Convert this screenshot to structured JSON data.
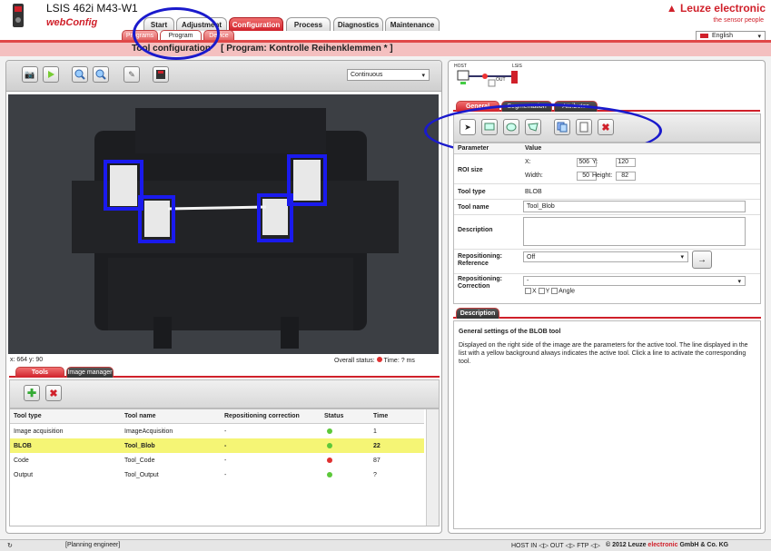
{
  "header": {
    "title": "LSIS 462i M43-W1",
    "subtitle": "webConfig",
    "brand": "Leuze electronic",
    "brand_tagline": "the sensor people",
    "language": "English",
    "main_tabs": [
      "Start",
      "Adjustment",
      "Configuration",
      "Process",
      "Diagnostics",
      "Maintenance"
    ],
    "sub_tabs": [
      "Programs",
      "Program",
      "Device"
    ],
    "page_heading": "Tool configuration    [ Program: Kontrolle Reihenklemmen * ]"
  },
  "viewer": {
    "mode": "Continuous",
    "coords": "x: 664 y: 90",
    "overall_status_label": "Overall status:",
    "time_label": "Time: ? ms"
  },
  "tools_panel": {
    "tabs": [
      "Tools",
      "Image manager"
    ],
    "columns": [
      "Tool type",
      "Tool name",
      "Repositioning correction",
      "Status",
      "Time"
    ],
    "rows": [
      {
        "type": "Image acquisition",
        "name": "ImageAcquisition",
        "repos": "-",
        "status": "green",
        "time": "1"
      },
      {
        "type": "BLOB",
        "name": "Tool_Blob",
        "repos": "-",
        "status": "green",
        "time": "22"
      },
      {
        "type": "Code",
        "name": "Tool_Code",
        "repos": "-",
        "status": "red",
        "time": "87"
      },
      {
        "type": "Output",
        "name": "Tool_Output",
        "repos": "-",
        "status": "green",
        "time": "?"
      }
    ]
  },
  "connection": {
    "host": "HOST",
    "device": "LSIS",
    "out": "OUT"
  },
  "right_panel": {
    "tabs": [
      "General",
      "Segmentation",
      "Attributes"
    ],
    "col_param": "Parameter",
    "col_value": "Value",
    "roi_label": "ROI size",
    "x_label": "X:",
    "x_value": "506",
    "y_label": "Y:",
    "y_value": "120",
    "width_label": "Width:",
    "width_value": "50",
    "height_label": "Height:",
    "height_value": "82",
    "tool_type_label": "Tool type",
    "tool_type_value": "BLOB",
    "tool_name_label": "Tool name",
    "tool_name_value": "Tool_Blob",
    "description_label": "Description",
    "repos_ref_label": "Repositioning: Reference",
    "repos_ref_value": "Off",
    "repos_corr_label": "Repositioning: Correction",
    "repos_corr_value": "-",
    "corr_checks": [
      "X",
      "Y",
      "Angle"
    ],
    "desc_tab": "Description",
    "desc_title": "General settings of the BLOB tool",
    "desc_text": "Displayed on the right side of the image are the parameters for the active tool. The line displayed in the list with a yellow background always indicates the active tool. Click a line to activate the corresponding tool."
  },
  "statusbar": {
    "role": "[Planning engineer]",
    "signals": "HOST IN ◁▷ OUT ◁▷ FTP ◁▷",
    "copyright_pre": "© 2012 Leuze",
    "copyright_brand": "electronic",
    "copyright_post": "GmbH & Co. KG"
  }
}
